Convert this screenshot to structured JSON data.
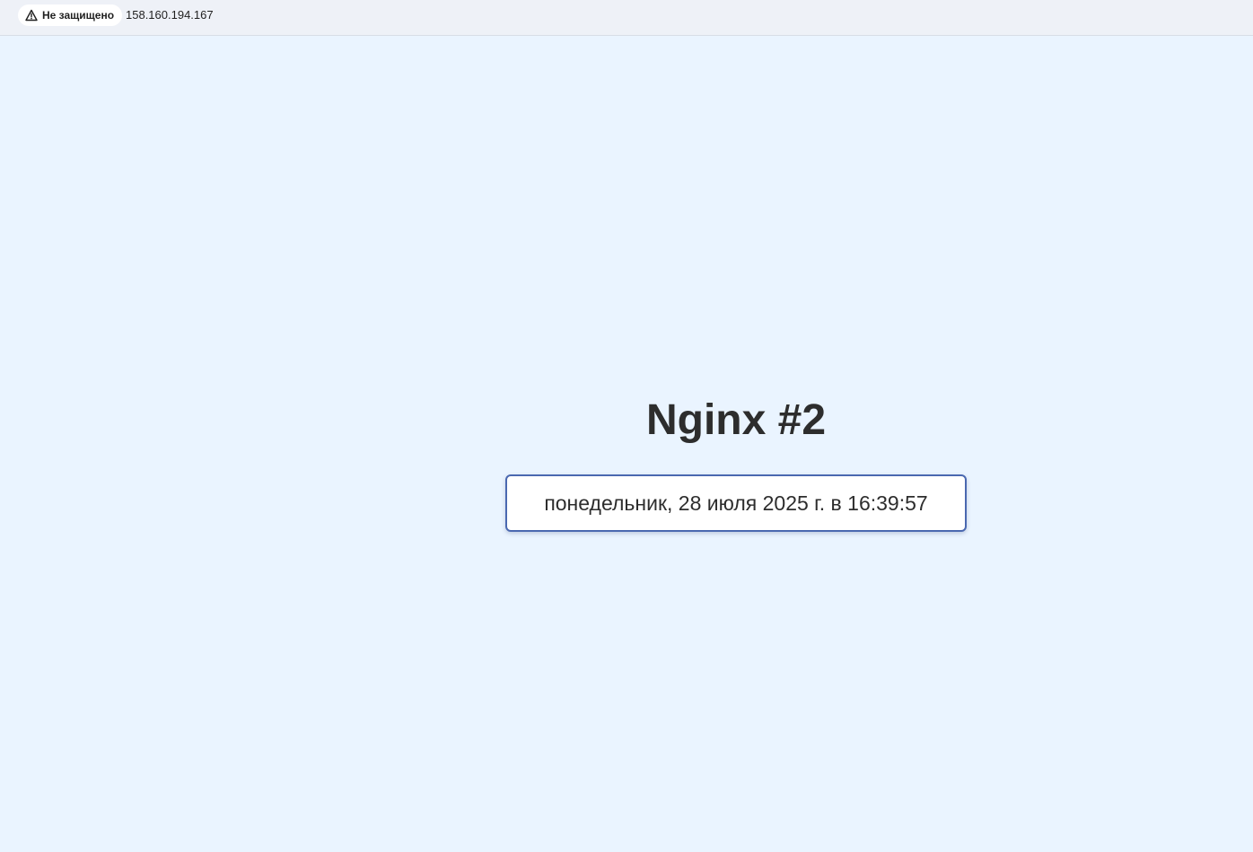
{
  "browser": {
    "security_label": "Не защищено",
    "url": "158.160.194.167"
  },
  "page": {
    "title": "Nginx #2",
    "datetime": "понедельник, 28 июля 2025 г. в 16:39:57"
  },
  "colors": {
    "page_background": "#eaf4ff",
    "box_border": "#4a68b0",
    "text": "#2d2d2d"
  },
  "icons": {
    "security": "warning-icon"
  }
}
